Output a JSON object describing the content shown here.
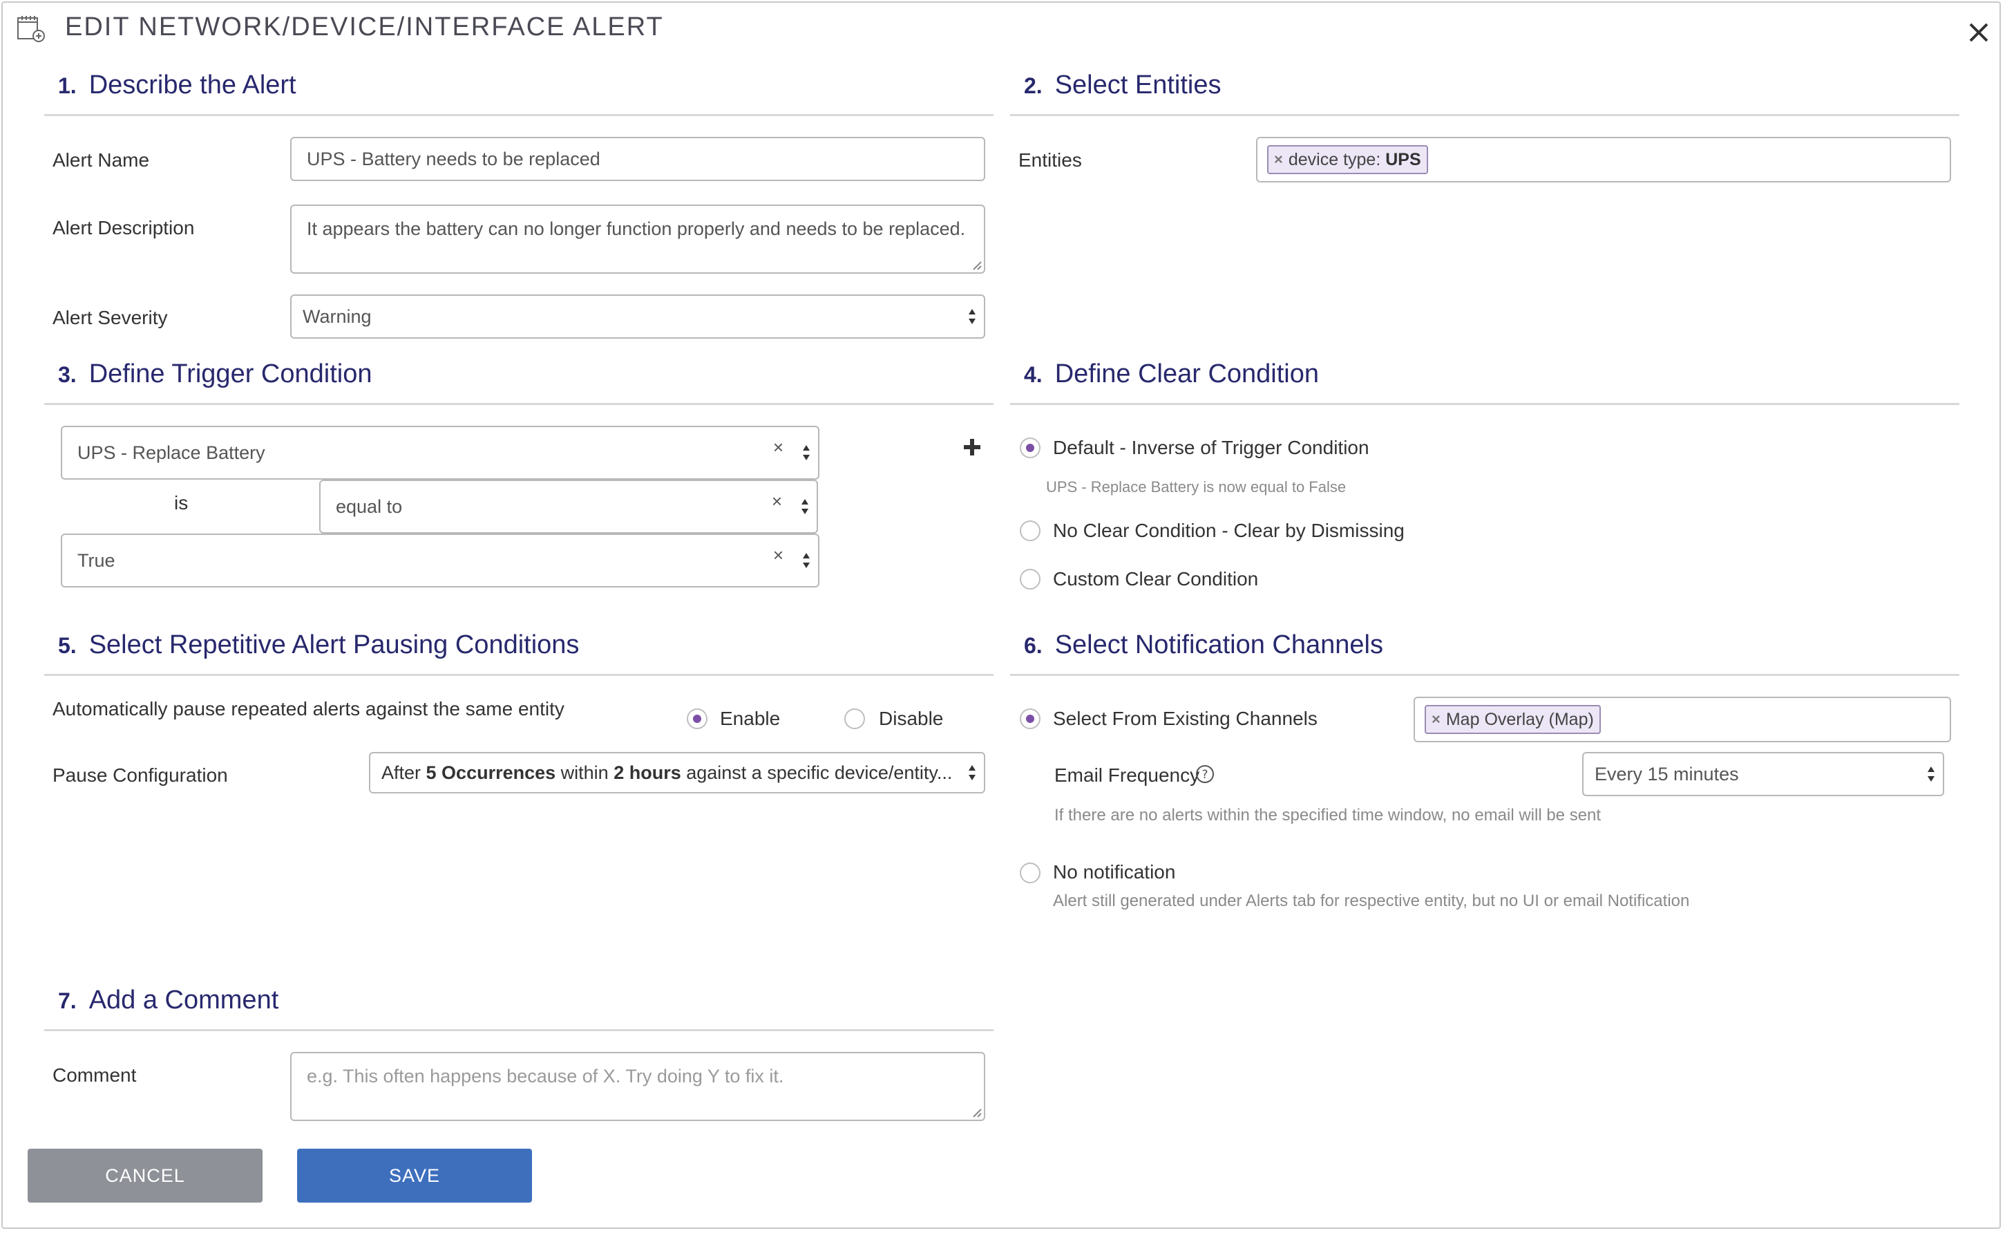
{
  "dialog": {
    "title": "EDIT NETWORK/DEVICE/INTERFACE ALERT"
  },
  "sections": {
    "describe": {
      "num": "1.",
      "title": "Describe the Alert"
    },
    "entities": {
      "num": "2.",
      "title": "Select Entities"
    },
    "trigger": {
      "num": "3.",
      "title": "Define Trigger Condition"
    },
    "clear": {
      "num": "4.",
      "title": "Define Clear Condition"
    },
    "pausing": {
      "num": "5.",
      "title": "Select Repetitive Alert Pausing Conditions"
    },
    "channels": {
      "num": "6.",
      "title": "Select Notification Channels"
    },
    "comment": {
      "num": "7.",
      "title": "Add a Comment"
    }
  },
  "describe": {
    "name_label": "Alert Name",
    "name_value": "UPS - Battery needs to be replaced",
    "description_label": "Alert Description",
    "description_value": "It appears the battery can no longer function properly and needs to be replaced.",
    "severity_label": "Alert Severity",
    "severity_value": "Warning"
  },
  "entities": {
    "label": "Entities",
    "tag_prefix": "device type: ",
    "tag_value": "UPS"
  },
  "trigger": {
    "metric": "UPS - Replace Battery",
    "is_label": "is",
    "operator": "equal to",
    "value": "True"
  },
  "clear": {
    "option_default": "Default - Inverse of Trigger Condition",
    "default_hint": "UPS - Replace Battery is now equal to False",
    "option_dismiss": "No Clear Condition - Clear by Dismissing",
    "option_custom": "Custom Clear Condition"
  },
  "pausing": {
    "description": "Automatically pause repeated alerts against the same entity",
    "enable_label": "Enable",
    "disable_label": "Disable",
    "config_label": "Pause Configuration",
    "config_parts": {
      "p1": "After ",
      "count": "5 Occurrences",
      "p2": " within ",
      "window": "2 hours",
      "p3": " against a specific device/entity..."
    }
  },
  "channels": {
    "option_existing": "Select From Existing Channels",
    "channel_tag": "Map Overlay (Map)",
    "email_frequency_label": "Email Frequency",
    "email_frequency_value": "Every 15 minutes",
    "email_hint": "If there are no alerts within the specified time window, no email will be sent",
    "option_none": "No notification",
    "none_hint": "Alert still generated under Alerts tab for respective entity, but no UI or email Notification"
  },
  "comment": {
    "label": "Comment",
    "placeholder": "e.g. This often happens because of X. Try doing Y to fix it."
  },
  "buttons": {
    "cancel": "CANCEL",
    "save": "SAVE"
  },
  "icons": {
    "dialog_icon": "calendar-add-icon",
    "close": "close-icon",
    "add": "plus-icon",
    "help": "help-circle-icon",
    "clear": "clear-x-icon",
    "select": "select-arrows-icon"
  },
  "colors": {
    "heading": "#28286e",
    "radio_selected": "#7b4fa6",
    "save": "#3d6fbd",
    "cancel": "#8e9197",
    "tag_bg": "#ece6f6"
  }
}
